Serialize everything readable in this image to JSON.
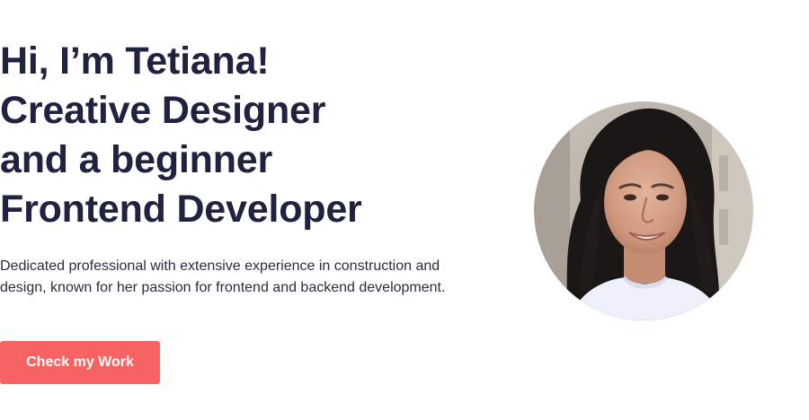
{
  "hero": {
    "headline_lines": [
      "Hi, I’m Tetiana!",
      "Creative Designer",
      "and a beginner",
      "Frontend Developer"
    ],
    "intro": "Dedicated professional with extensive experience in construction and design, known for her passion for frontend and backend development.",
    "cta_label": "Check my Work",
    "accent_color": "#f76363",
    "heading_color": "#20233f"
  },
  "profile_photo": {
    "icon": "portrait-photo"
  }
}
